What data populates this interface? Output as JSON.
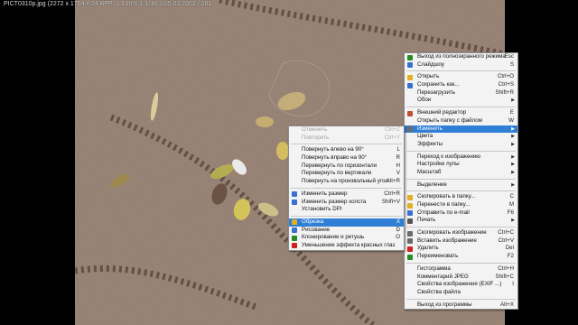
{
  "title": "PICT0310p.jpg (2272 x 1704 x 24 BPP) 1 100% 1 1/16 1 05.03.2002 / 201",
  "main_menu": {
    "items": [
      {
        "label": "Выход из полноэкранного режима",
        "shortcut": "Esc",
        "icon": "exit-fullscreen-icon",
        "color": "#2a8a2a"
      },
      {
        "label": "Слайдшоу",
        "shortcut": "S",
        "icon": "slideshow-icon",
        "color": "#3a6fd0"
      },
      {
        "sep": true
      },
      {
        "label": "Открыть",
        "shortcut": "Ctrl+O",
        "icon": "open-folder-icon",
        "color": "#e0b020"
      },
      {
        "label": "Сохранить как...",
        "shortcut": "Ctrl+S",
        "icon": "save-icon",
        "color": "#3a6fd0"
      },
      {
        "label": "Перезагрузить",
        "shortcut": "Shift+R"
      },
      {
        "label": "Обои",
        "arrow": true
      },
      {
        "sep": true
      },
      {
        "label": "Внешний редактор",
        "shortcut": "E",
        "icon": "edit-icon",
        "color": "#c05030"
      },
      {
        "label": "Открыть папку с файлом",
        "shortcut": "W"
      },
      {
        "label": "Изменить",
        "arrow": true,
        "highlight": true,
        "icon": "wrench-icon",
        "color": "#6a6a6a"
      },
      {
        "label": "Цвета",
        "arrow": true
      },
      {
        "label": "Эффекты",
        "arrow": true
      },
      {
        "sep": true
      },
      {
        "label": "Переход к изображению",
        "arrow": true
      },
      {
        "label": "Настройки лупы",
        "arrow": true
      },
      {
        "label": "Масштаб",
        "arrow": true
      },
      {
        "sep": true
      },
      {
        "label": "Выделение",
        "arrow": true
      },
      {
        "sep": true
      },
      {
        "label": "Скопировать в папку...",
        "shortcut": "C",
        "icon": "copy-folder-icon",
        "color": "#e0b020"
      },
      {
        "label": "Перенести в папку...",
        "shortcut": "M",
        "icon": "move-folder-icon",
        "color": "#e0b020"
      },
      {
        "label": "Отправить по e-mail",
        "shortcut": "F6",
        "icon": "email-icon",
        "color": "#3a6fd0"
      },
      {
        "label": "Печать",
        "arrow": true,
        "icon": "print-icon",
        "color": "#555555"
      },
      {
        "sep": true
      },
      {
        "label": "Скопировать изображение",
        "shortcut": "Ctrl+C",
        "icon": "copy-image-icon",
        "color": "#6a6a6a"
      },
      {
        "label": "Вставить изображение",
        "shortcut": "Ctrl+V",
        "icon": "paste-image-icon",
        "color": "#6a6a6a"
      },
      {
        "label": "Удалить",
        "shortcut": "Del",
        "icon": "delete-icon",
        "color": "#d02020"
      },
      {
        "label": "Переименовать",
        "shortcut": "F2",
        "icon": "rename-icon",
        "color": "#2a8a2a"
      },
      {
        "sep": true
      },
      {
        "label": "Гистограмма",
        "shortcut": "Ctrl+H"
      },
      {
        "label": "Комментарий JPEG",
        "shortcut": "Shift+C"
      },
      {
        "label": "Свойства изображения (EXIF ...)",
        "shortcut": "I"
      },
      {
        "label": "Свойства файла"
      },
      {
        "sep": true
      },
      {
        "label": "Выход из программы",
        "shortcut": "Alt+X"
      }
    ]
  },
  "edit_submenu": {
    "items": [
      {
        "label": "Отменить",
        "shortcut": "Ctrl+Z",
        "disabled": true
      },
      {
        "label": "Повторить",
        "shortcut": "Ctrl+Y",
        "disabled": true
      },
      {
        "sep": true
      },
      {
        "label": "Повернуть влево на 90°",
        "shortcut": "L"
      },
      {
        "label": "Повернуть вправо на 90°",
        "shortcut": "R"
      },
      {
        "label": "Перевернуть по горизонтали",
        "shortcut": "H"
      },
      {
        "label": "Перевернуть по вертикали",
        "shortcut": "V"
      },
      {
        "label": "Повернуть на произвольный угол",
        "shortcut": "Alt+R"
      },
      {
        "sep": true
      },
      {
        "label": "Изменить размер",
        "shortcut": "Ctrl+R",
        "icon": "resize-icon",
        "color": "#3a6fd0"
      },
      {
        "label": "Изменить размер холста",
        "shortcut": "Shift+V",
        "icon": "canvas-size-icon",
        "color": "#3a6fd0"
      },
      {
        "label": "Установить DPI"
      },
      {
        "sep": true
      },
      {
        "label": "Обрезка",
        "shortcut": "X",
        "highlight": true,
        "icon": "crop-icon",
        "color": "#e0b020"
      },
      {
        "label": "Рисование",
        "shortcut": "D",
        "icon": "paint-icon",
        "color": "#3a6fd0"
      },
      {
        "label": "Клонирование и ретушь",
        "shortcut": "O",
        "icon": "clone-icon",
        "color": "#2a8a2a"
      },
      {
        "label": "Уменьшение эффекта красных глаз",
        "icon": "red-eye-icon",
        "color": "#d02020"
      }
    ]
  }
}
